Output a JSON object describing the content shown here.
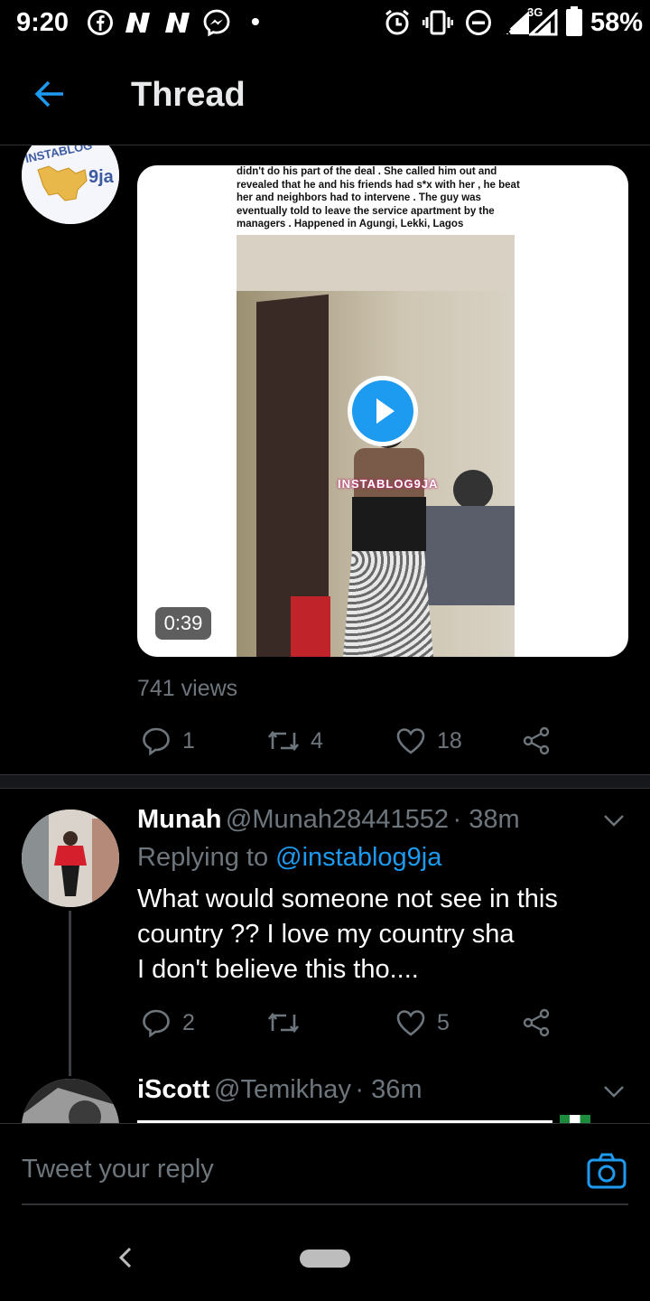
{
  "status_bar": {
    "time": "9:20",
    "battery_pct": "58%",
    "network": "3G"
  },
  "header": {
    "title": "Thread"
  },
  "main_tweet": {
    "caption": "didn't do his part of the deal . She called him out and revealed that he and his friends had s*x with her , he beat her and neighbors had to intervene . The guy was eventually told to leave the service apartment by the managers . Happened in Agungi, Lekki, Lagos",
    "watermark": "INSTABLOG9JA",
    "avatar_logo": "INSTABLOG 9ja",
    "duration": "0:39",
    "views": "741 views",
    "actions": {
      "replies": "1",
      "retweets": "4",
      "likes": "18"
    }
  },
  "replies": [
    {
      "name": "Munah",
      "handle": "@Munah28441552",
      "time": "· 38m",
      "replying_prefix": "Replying to",
      "replying_to": "@instablog9ja",
      "text_lines": [
        "What would someone not see in this",
        "country ?? I love my country sha",
        "I don't believe this tho...."
      ],
      "actions": {
        "replies": "2",
        "retweets": "",
        "likes": "5"
      }
    },
    {
      "name": "iScott",
      "handle": "@Temikhay",
      "time": "· 36m"
    }
  ],
  "compose": {
    "placeholder": "Tweet your reply"
  },
  "colors": {
    "accent": "#1d9bf0",
    "muted": "#6e767d",
    "background": "#000000",
    "divider": "#2f3336"
  },
  "icons": [
    "back-arrow-icon",
    "reply-icon",
    "retweet-icon",
    "like-icon",
    "share-icon",
    "chevron-down-icon",
    "camera-icon",
    "play-icon"
  ]
}
